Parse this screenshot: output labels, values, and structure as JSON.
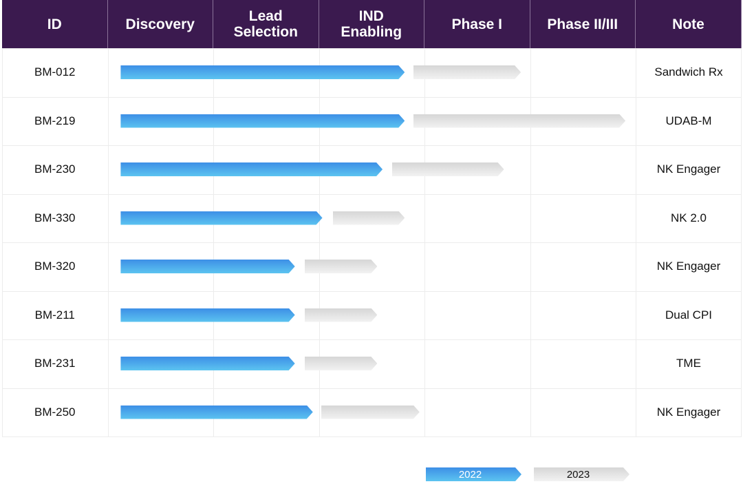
{
  "chart_data": {
    "type": "gantt",
    "columns": [
      "ID",
      "Discovery",
      "Lead Selection",
      "IND Enabling",
      "Phase I",
      "Phase II/III",
      "Note"
    ],
    "stages": [
      "Discovery",
      "Lead Selection",
      "IND Enabling",
      "Phase I",
      "Phase II/III"
    ],
    "stage_units_note_free": true,
    "rows": [
      {
        "id": "BM-012",
        "note": "Sandwich Rx",
        "y2022": [
          0.12,
          2.81
        ],
        "y2023": [
          2.89,
          3.91
        ]
      },
      {
        "id": "BM-219",
        "note": "UDAB-M",
        "y2022": [
          0.12,
          2.81
        ],
        "y2023": [
          2.89,
          4.9
        ]
      },
      {
        "id": "BM-230",
        "note": "NK Engager",
        "y2022": [
          0.12,
          2.6
        ],
        "y2023": [
          2.69,
          3.75
        ]
      },
      {
        "id": "BM-330",
        "note": "NK 2.0",
        "y2022": [
          0.12,
          2.03
        ],
        "y2023": [
          2.13,
          2.81
        ]
      },
      {
        "id": "BM-320",
        "note": "NK Engager",
        "y2022": [
          0.12,
          1.77
        ],
        "y2023": [
          1.86,
          2.55
        ]
      },
      {
        "id": "BM-211",
        "note": "Dual CPI",
        "y2022": [
          0.12,
          1.77
        ],
        "y2023": [
          1.86,
          2.55
        ]
      },
      {
        "id": "BM-231",
        "note": "TME",
        "y2022": [
          0.12,
          1.77
        ],
        "y2023": [
          1.86,
          2.55
        ]
      },
      {
        "id": "BM-250",
        "note": "NK Engager",
        "y2022": [
          0.12,
          1.94
        ],
        "y2023": [
          2.02,
          2.95
        ]
      }
    ],
    "legend": [
      {
        "name": "2022",
        "color": "#3d8fe6"
      },
      {
        "name": "2023",
        "color": "#dcdcdc"
      }
    ],
    "legend_placement": "bottom-right",
    "header_color": "#3b1a4f"
  }
}
